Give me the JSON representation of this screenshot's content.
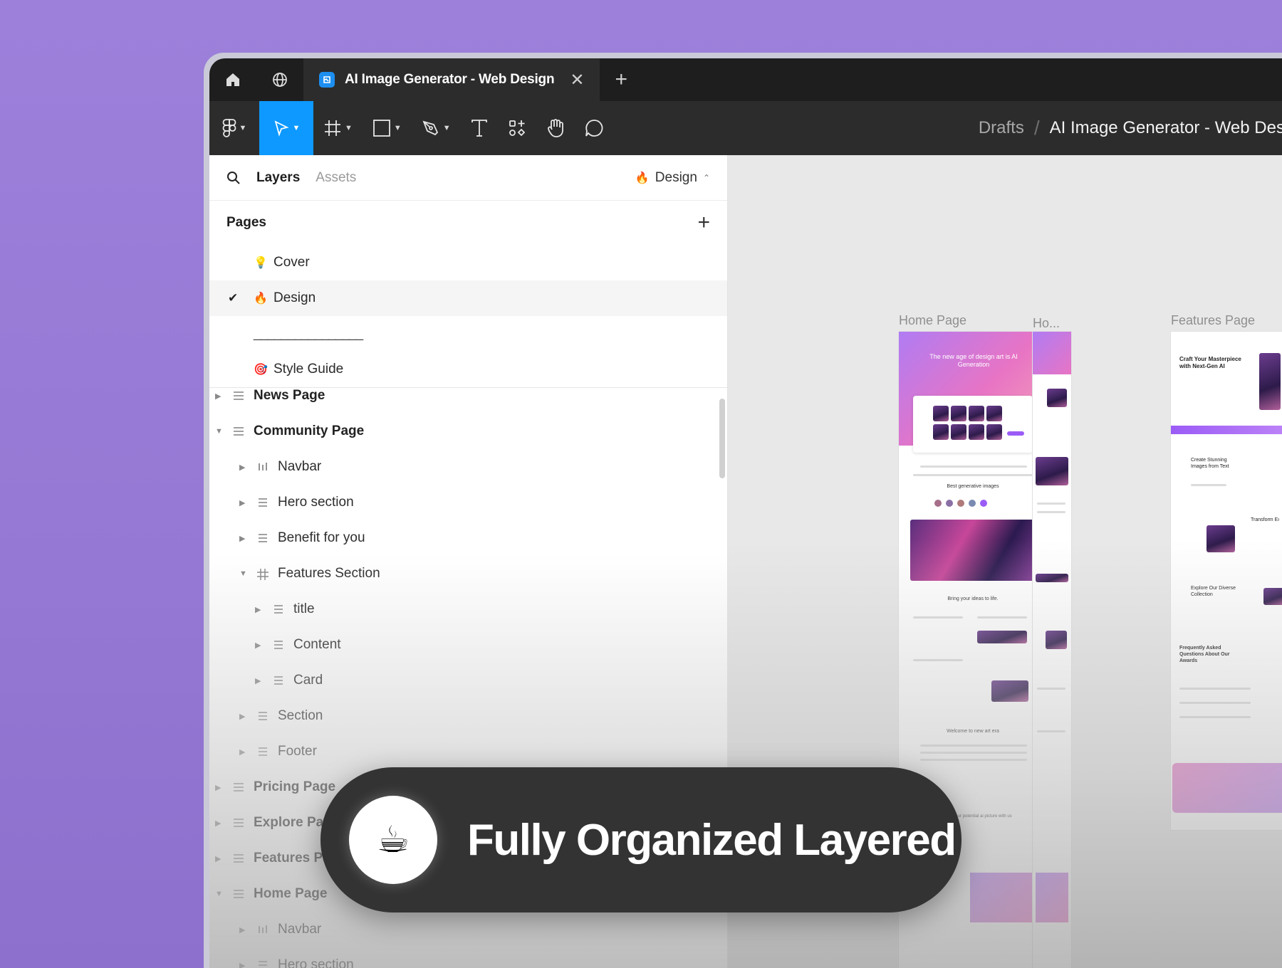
{
  "tabs": {
    "active_title": "AI Image Generator - Web Design",
    "close_glyph": "✕",
    "add_glyph": "+"
  },
  "breadcrumb": {
    "root": "Drafts",
    "separator": "/",
    "file": "AI Image Generator - Web Design"
  },
  "panel": {
    "layers_tab": "Layers",
    "assets_tab": "Assets",
    "page_selector": "Design",
    "pages_header": "Pages",
    "add_glyph": "+"
  },
  "pages": [
    {
      "label": "Cover",
      "emoji": "💡",
      "selected": false
    },
    {
      "label": "Design",
      "emoji": "🔥",
      "selected": true
    },
    {
      "label": "________________",
      "emoji": "",
      "selected": false
    },
    {
      "label": "Style Guide",
      "emoji": "🎯",
      "selected": false
    }
  ],
  "layers": [
    {
      "label": "News Page",
      "depth": 0,
      "expanded": false,
      "icon": "section-icon",
      "bold": true
    },
    {
      "label": "Community Page",
      "depth": 0,
      "expanded": true,
      "icon": "section-icon",
      "bold": true
    },
    {
      "label": "Navbar",
      "depth": 1,
      "expanded": false,
      "icon": "columns-icon",
      "bold": false
    },
    {
      "label": "Hero section",
      "depth": 1,
      "expanded": false,
      "icon": "rows-icon",
      "bold": false
    },
    {
      "label": "Benefit for you",
      "depth": 1,
      "expanded": false,
      "icon": "rows-icon",
      "bold": false
    },
    {
      "label": "Features Section",
      "depth": 1,
      "expanded": true,
      "icon": "frame-icon",
      "bold": false
    },
    {
      "label": "title",
      "depth": 2,
      "expanded": false,
      "icon": "rows-icon",
      "bold": false
    },
    {
      "label": "Content",
      "depth": 2,
      "expanded": false,
      "icon": "rows-icon",
      "bold": false
    },
    {
      "label": "Card",
      "depth": 2,
      "expanded": false,
      "icon": "rows-icon",
      "bold": false
    },
    {
      "label": "Section",
      "depth": 1,
      "expanded": false,
      "icon": "rows-icon",
      "bold": false
    },
    {
      "label": "Footer",
      "depth": 1,
      "expanded": false,
      "icon": "rows-icon",
      "bold": false
    },
    {
      "label": "Pricing Page",
      "depth": 0,
      "expanded": false,
      "icon": "section-icon",
      "bold": true
    },
    {
      "label": "Explore Page",
      "depth": 0,
      "expanded": false,
      "icon": "section-icon",
      "bold": true
    },
    {
      "label": "Features Page",
      "depth": 0,
      "expanded": false,
      "icon": "section-icon",
      "bold": true
    },
    {
      "label": "Home Page",
      "depth": 0,
      "expanded": true,
      "icon": "section-icon",
      "bold": true
    },
    {
      "label": "Navbar",
      "depth": 1,
      "expanded": false,
      "icon": "columns-icon",
      "bold": false
    },
    {
      "label": "Hero section",
      "depth": 1,
      "expanded": false,
      "icon": "rows-icon",
      "bold": false
    }
  ],
  "canvas": {
    "frames": [
      {
        "label": "Home Page"
      },
      {
        "label": "Ho..."
      },
      {
        "label": "Features Page"
      }
    ],
    "home_hero_text": "The new age of design art is AI Generation",
    "features_hero_text": "Craft Your Masterpiece with Next-Gen AI",
    "best_images_text": "Best generative images",
    "bring_ideas_text": "Bring your ideas to life.",
    "welcome_text": "Welcome to new art era",
    "maximize_text": "Maximize your potential ai picture with us",
    "create_text": "Create Stunning Images from Text",
    "transform_text": "Transform Existing Im",
    "explore_text": "Explore Our Diverse Collection",
    "faq_text": "Frequently Asked Questions About Our Awards"
  },
  "banner": {
    "text": "Fully Organized Layered",
    "emoji": "☕"
  },
  "colors": {
    "background": "#9b7fd8",
    "accent": "#0d99ff",
    "toolbar": "#2c2c2c",
    "tabbar": "#1e1e1e",
    "pill": "#333333"
  }
}
